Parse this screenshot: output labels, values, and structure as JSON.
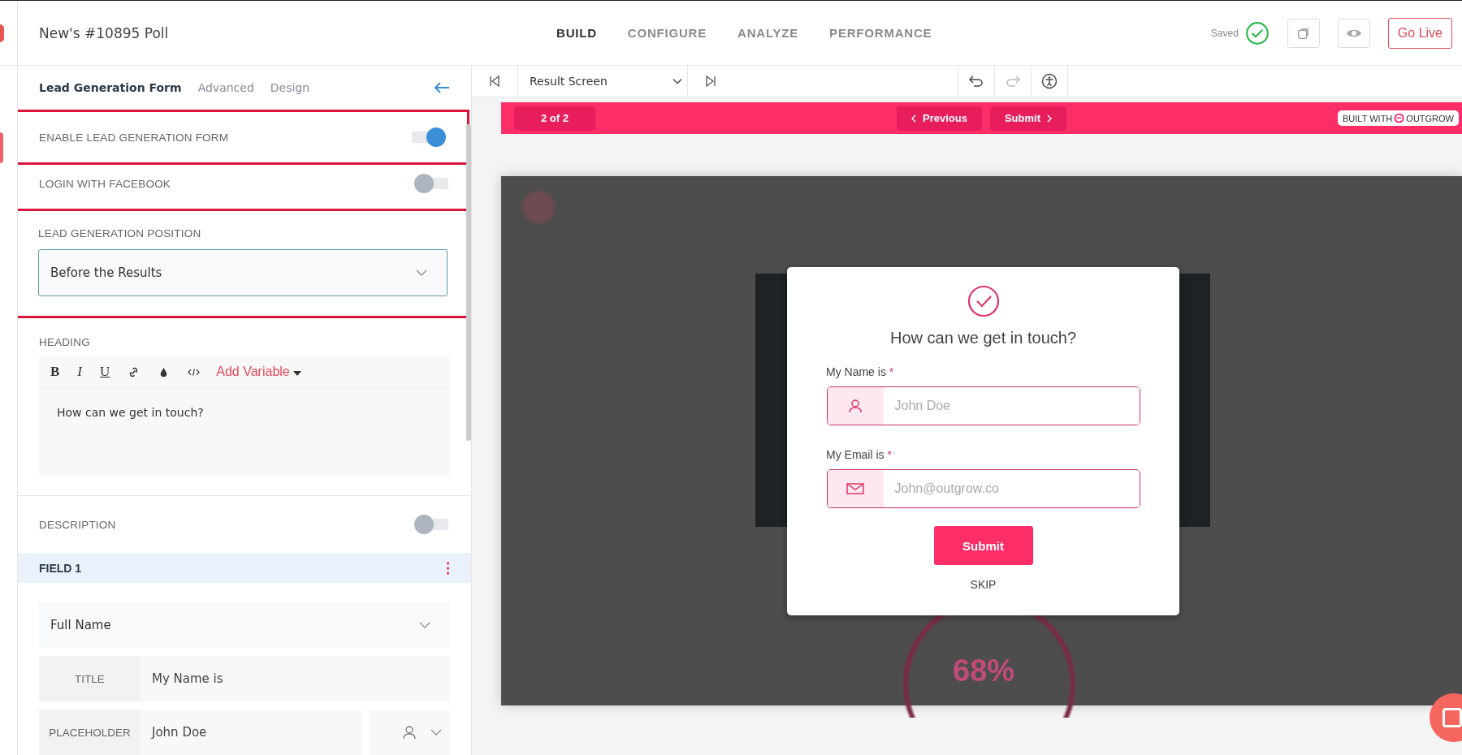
{
  "header": {
    "title": "New's #10895 Poll",
    "nav": [
      {
        "label": "BUILD",
        "selected": true
      },
      {
        "label": "CONFIGURE",
        "selected": false
      },
      {
        "label": "ANALYZE",
        "selected": false
      },
      {
        "label": "PERFORMANCE",
        "selected": false
      }
    ],
    "saved": "Saved",
    "go_live": "Go Live"
  },
  "panel": {
    "tabs": [
      {
        "label": "Lead Generation Form",
        "selected": true
      },
      {
        "label": "Advanced",
        "selected": false
      },
      {
        "label": "Design",
        "selected": false
      }
    ],
    "toggles": [
      {
        "label": "ENABLE LEAD GENERATION FORM",
        "on": true,
        "highlighted": true
      },
      {
        "label": "LOGIN WITH FACEBOOK",
        "on": false,
        "highlighted": false
      }
    ],
    "position": {
      "label": "LEAD GENERATION POSITION",
      "value": "Before the Results",
      "highlighted": true
    },
    "heading": {
      "label": "HEADING",
      "toolbar": [
        "B",
        "I",
        "U"
      ],
      "add_variable": "Add Variable",
      "text": "How can we get in touch?"
    },
    "description": {
      "label": "DESCRIPTION",
      "on": false
    },
    "field": {
      "label": "FIELD 1",
      "type": "Full Name",
      "title_label": "TITLE",
      "title": "My Name is",
      "placeholder_label": "PLACEHOLDER",
      "placeholder": "John Doe"
    }
  },
  "preview": {
    "screen": "Result Screen",
    "page": "2 of 2",
    "previous": "Previous",
    "submit_nav": "Submit",
    "built_with": "BUILT WITH",
    "brand": "OUTGROW",
    "background_figure": "68%",
    "modal": {
      "heading": "How can we get in touch?",
      "fields": [
        {
          "label": "My Name is",
          "required_mark": "*",
          "placeholder": "John Doe",
          "kind": "person"
        },
        {
          "label": "My Email is",
          "required_mark": "*",
          "placeholder": "John@outgrow.co",
          "kind": "email"
        }
      ],
      "submit": "Submit",
      "skip": "SKIP"
    }
  }
}
